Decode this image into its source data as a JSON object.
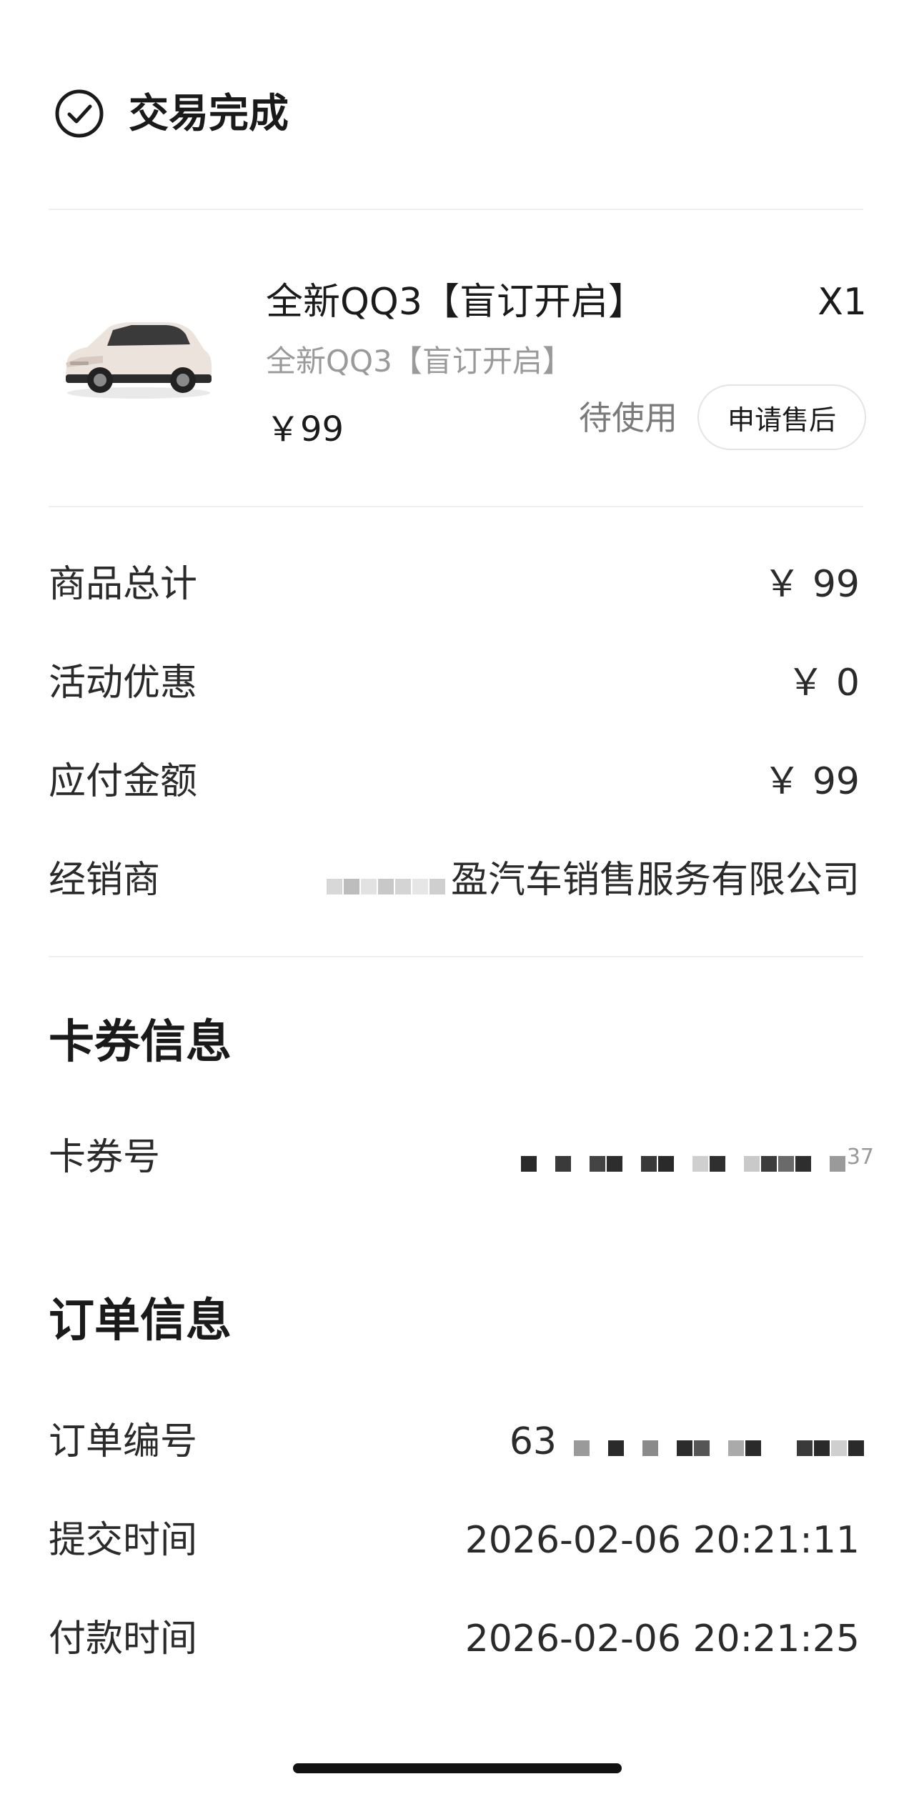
{
  "header": {
    "status_title": "交易完成"
  },
  "product": {
    "name": "全新QQ3【盲订开启】",
    "subtitle": "全新QQ3【盲订开启】",
    "quantity": "X1",
    "price": "￥99",
    "status": "待使用",
    "after_sale_label": "申请售后"
  },
  "summary": {
    "rows": [
      {
        "label": "商品总计",
        "value": "￥ 99"
      },
      {
        "label": "活动优惠",
        "value": "￥ 0"
      },
      {
        "label": "应付金额",
        "value": "￥ 99"
      },
      {
        "label": "经销商",
        "value": "盈汽车销售服务有限公司"
      }
    ]
  },
  "coupon": {
    "section_title": "卡券信息",
    "number_label": "卡券号",
    "number_visible": "37"
  },
  "order": {
    "section_title": "订单信息",
    "number_label": "订单编号",
    "number_prefix": "63",
    "submit_label": "提交时间",
    "submit_value": "2026-02-06 20:21:11",
    "pay_label": "付款时间",
    "pay_value": "2026-02-06 20:21:25"
  },
  "icons": {
    "status": "check-circle-icon",
    "car": "car-image"
  }
}
